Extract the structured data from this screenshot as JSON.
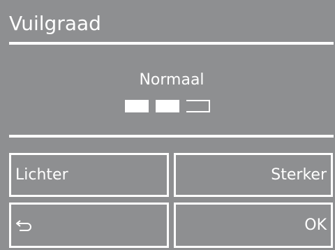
{
  "header": {
    "title": "Vuilgraad"
  },
  "soil_level": {
    "label": "Normaal",
    "segments_total": 3,
    "segments_filled": 2
  },
  "buttons": {
    "lighter": "Lichter",
    "stronger": "Sterker",
    "back_icon": "back-arrow-icon",
    "ok": "OK"
  },
  "colors": {
    "background": "#8e8f91",
    "foreground": "#ffffff"
  }
}
